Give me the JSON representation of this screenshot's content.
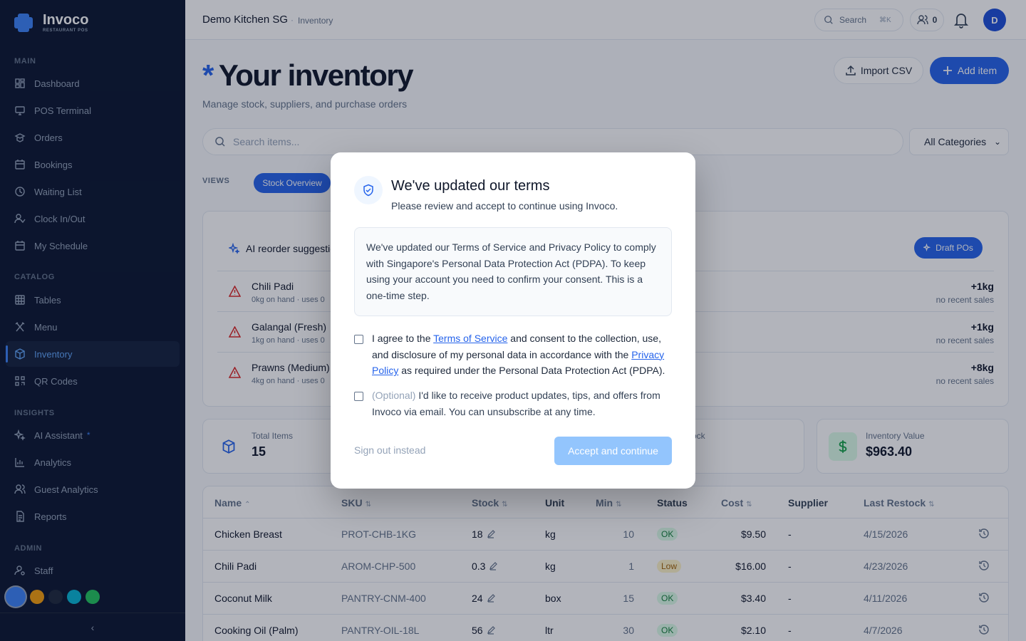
{
  "brand": {
    "name": "Invoco",
    "subtitle": "RESTAURANT POS"
  },
  "sidebar": {
    "sections": [
      "MAIN",
      "CATALOG",
      "INSIGHTS",
      "ADMIN"
    ],
    "items": [
      {
        "label": "Dashboard",
        "icon": "dashboard-icon"
      },
      {
        "label": "POS Terminal",
        "icon": "monitor-icon"
      },
      {
        "label": "Orders",
        "icon": "orders-icon"
      },
      {
        "label": "Bookings",
        "icon": "calendar-icon"
      },
      {
        "label": "Waiting List",
        "icon": "clock-icon"
      },
      {
        "label": "Clock In/Out",
        "icon": "user-check-icon"
      },
      {
        "label": "My Schedule",
        "icon": "calendar-icon"
      },
      {
        "label": "Tables",
        "icon": "grid-icon"
      },
      {
        "label": "Menu",
        "icon": "utensils-icon"
      },
      {
        "label": "Inventory",
        "icon": "box-icon",
        "active": true
      },
      {
        "label": "QR Codes",
        "icon": "qr-icon"
      },
      {
        "label": "AI Assistant",
        "icon": "sparkles-icon",
        "badge": "*"
      },
      {
        "label": "Analytics",
        "icon": "bar-chart-icon"
      },
      {
        "label": "Guest Analytics",
        "icon": "users-icon"
      },
      {
        "label": "Reports",
        "icon": "file-icon"
      },
      {
        "label": "Staff",
        "icon": "user-icon"
      }
    ],
    "theme_swatches": [
      "#3b82f6",
      "#f59e0b",
      "#1e293b",
      "#06b6d4",
      "#22c55e"
    ],
    "collapse_glyph": "‹"
  },
  "topbar": {
    "restaurant": "Demo Kitchen SG",
    "separator": "·",
    "page": "Inventory",
    "search_label": "Search",
    "search_shortcut": "⌘K",
    "online_count": "0",
    "avatar_initial": "D"
  },
  "page": {
    "title_mark": "*",
    "title": "Your inventory",
    "subtitle": "Manage stock, suppliers, and purchase orders",
    "import_label": "Import CSV",
    "add_label": "Add item",
    "search_placeholder": "Search items...",
    "category_selected": "All Categories",
    "views_label": "VIEWS",
    "active_view": "Stock Overview"
  },
  "ai_card": {
    "title": "AI reorder suggestio",
    "draft_label": "Draft POs",
    "rows": [
      {
        "name": "Chili Padi",
        "meta": "0kg on hand · uses 0",
        "qty": "+1kg",
        "qty_meta": "no recent sales"
      },
      {
        "name": "Galangal (Fresh)",
        "meta": "1kg on hand · uses 0",
        "qty": "+1kg",
        "qty_meta": "no recent sales"
      },
      {
        "name": "Prawns (Medium)",
        "meta": "4kg on hand · uses 0",
        "qty": "+8kg",
        "qty_meta": "no recent sales"
      }
    ]
  },
  "stats": [
    {
      "label": "Total Items",
      "value": "15",
      "icon": "box-icon"
    },
    {
      "label": "ock",
      "value": "",
      "icon": ""
    },
    {
      "label": "Inventory Value",
      "value": "$963.40",
      "icon": "dollar-icon"
    }
  ],
  "table": {
    "headers": [
      "Name",
      "SKU",
      "Stock",
      "Unit",
      "Min",
      "Status",
      "Cost",
      "Supplier",
      "Last Restock"
    ],
    "rows": [
      {
        "name": "Chicken Breast",
        "sku": "PROT-CHB-1KG",
        "stock": "18",
        "unit": "kg",
        "min": "10",
        "status": "OK",
        "cost": "$9.50",
        "supplier": "-",
        "restock": "4/15/2026"
      },
      {
        "name": "Chili Padi",
        "sku": "AROM-CHP-500",
        "stock": "0.3",
        "unit": "kg",
        "min": "1",
        "status": "Low",
        "cost": "$16.00",
        "supplier": "-",
        "restock": "4/23/2026"
      },
      {
        "name": "Coconut Milk",
        "sku": "PANTRY-CNM-400",
        "stock": "24",
        "unit": "box",
        "min": "15",
        "status": "OK",
        "cost": "$3.40",
        "supplier": "-",
        "restock": "4/11/2026"
      },
      {
        "name": "Cooking Oil (Palm)",
        "sku": "PANTRY-OIL-18L",
        "stock": "56",
        "unit": "ltr",
        "min": "30",
        "status": "OK",
        "cost": "$2.10",
        "supplier": "-",
        "restock": "4/7/2026"
      }
    ]
  },
  "modal": {
    "title": "We've updated our terms",
    "subtitle": "Please review and accept to continue using Invoco.",
    "body": "We've updated our Terms of Service and Privacy Policy to comply with Singapore's Personal Data Protection Act (PDPA). To keep using your account you need to confirm your consent. This is a one-time step.",
    "consent_before": "I agree to the ",
    "terms_link": "Terms of Service",
    "consent_middle": " and consent to the collection, use, and disclosure of my personal data in accordance with the ",
    "privacy_link": "Privacy Policy",
    "consent_after": " as required under the Personal Data Protection Act (PDPA).",
    "optional_tag": "(Optional)",
    "optin_text": " I'd like to receive product updates, tips, and offers from Invoco via email. You can unsubscribe at any time.",
    "sign_out_label": "Sign out instead",
    "accept_label": "Accept and continue"
  }
}
